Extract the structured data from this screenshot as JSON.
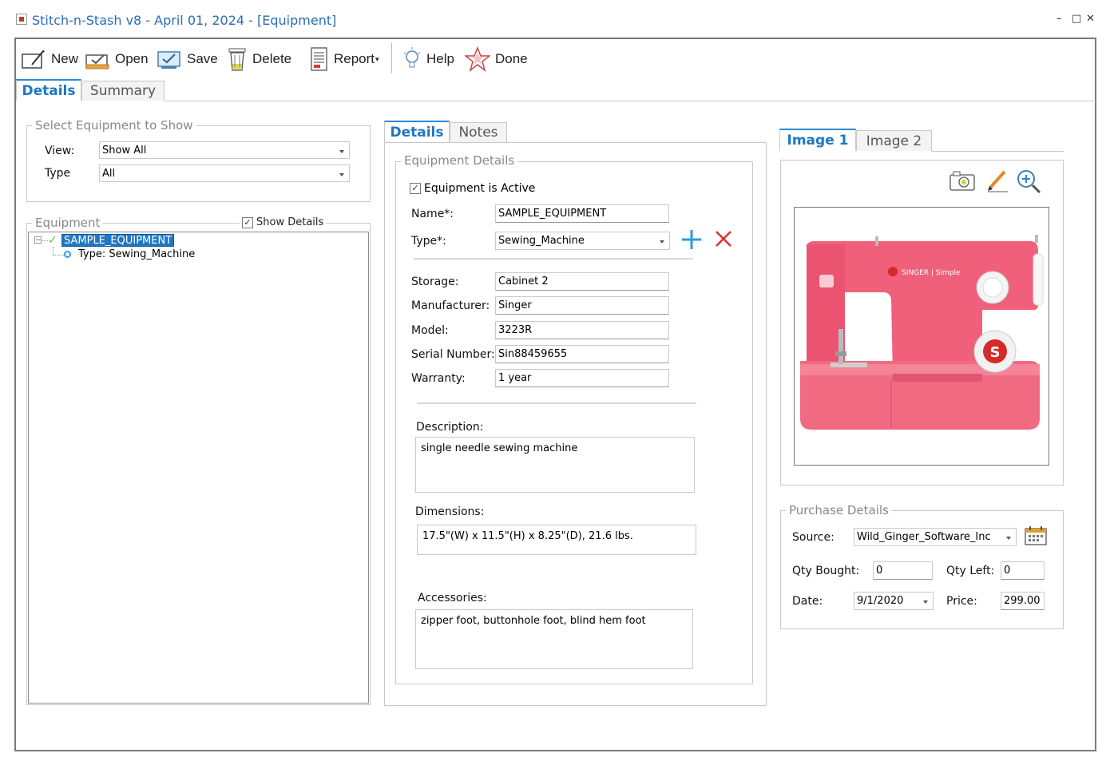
{
  "window": {
    "title": "Stitch-n-Stash v8 - April 01, 2024 - [Equipment]",
    "minimize": "–",
    "maximize": "□",
    "close": "✕"
  },
  "toolbar": {
    "new": "New",
    "open": "Open",
    "save": "Save",
    "delete": "Delete",
    "report": "Report",
    "help": "Help",
    "done": "Done"
  },
  "main_tabs": [
    "Details",
    "Summary"
  ],
  "select_group": {
    "legend": "Select Equipment to Show",
    "view_label": "View:",
    "view_value": "Show All",
    "type_label": "Type",
    "type_value": "All"
  },
  "equipment_group": {
    "legend": "Equipment",
    "show_details_label": "Show Details",
    "show_details_checked": true,
    "tree": {
      "item": "SAMPLE_EQUIPMENT",
      "child": "Type: Sewing_Machine"
    }
  },
  "detail_tabs": [
    "Details",
    "Notes"
  ],
  "equipment_details": {
    "legend": "Equipment Details",
    "active_label": "Equipment is Active",
    "active_checked": true,
    "name_label": "Name*:",
    "name_value": "SAMPLE_EQUIPMENT",
    "type_label": "Type*:",
    "type_value": "Sewing_Machine",
    "storage_label": "Storage:",
    "storage_value": "Cabinet 2",
    "manufacturer_label": "Manufacturer:",
    "manufacturer_value": "Singer",
    "model_label": "Model:",
    "model_value": "3223R",
    "serial_label": "Serial Number:",
    "serial_value": "Sin88459655",
    "warranty_label": "Warranty:",
    "warranty_value": "1 year",
    "description_label": "Description:",
    "description_value": "single needle sewing machine",
    "dimensions_label": "Dimensions:",
    "dimensions_value": "17.5\"(W) x 11.5\"(H) x 8.25\"(D), 21.6 lbs.",
    "accessories_label": "Accessories:",
    "accessories_value": "zipper foot, buttonhole foot, blind hem foot"
  },
  "image_tabs": [
    "Image 1",
    "Image 2"
  ],
  "machine_image": {
    "brand_text": "SINGER | Simple",
    "logo_letter": "S"
  },
  "purchase": {
    "legend": "Purchase Details",
    "source_label": "Source:",
    "source_value": "Wild_Ginger_Software_Inc",
    "qty_bought_label": "Qty Bought:",
    "qty_bought_value": "0",
    "qty_left_label": "Qty Left:",
    "qty_left_value": "0",
    "date_label": "Date:",
    "date_value": "9/1/2020",
    "price_label": "Price:",
    "price_value": "299.00"
  },
  "colors": {
    "accent": "#1f77c4",
    "add_icon": "#2b9be0",
    "delete_icon": "#e03030",
    "machine_pink": "#f0607a",
    "selection": "#1f77c4"
  }
}
